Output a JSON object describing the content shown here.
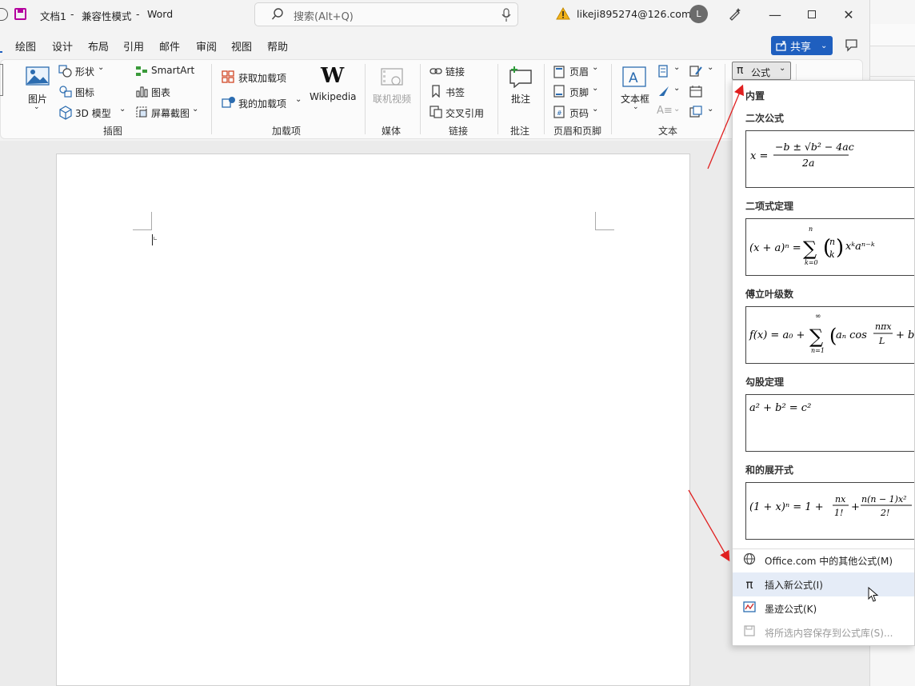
{
  "title": {
    "doc_name": "文档1",
    "separator1": "-",
    "mode": "兼容性模式",
    "separator2": "-",
    "app": "Word",
    "search_placeholder": "搜索(Alt+Q)",
    "account": "likeji895274@126.com",
    "avatar_letter": "L"
  },
  "menu": {
    "items": [
      "绘图",
      "设计",
      "布局",
      "引用",
      "邮件",
      "审阅",
      "视图",
      "帮助"
    ],
    "share": "共享"
  },
  "ribbon": {
    "illustrations": {
      "picture": "图片",
      "shapes": "形状",
      "icons": "图标",
      "model3d": "3D 模型",
      "smartart": "SmartArt",
      "chart": "图表",
      "screenshot": "屏幕截图",
      "group": "插图"
    },
    "addins": {
      "get": "获取加载项",
      "mine": "我的加载项",
      "wikipedia": "Wikipedia",
      "group": "加载项"
    },
    "media": {
      "online_video": "联机视频",
      "group": "媒体"
    },
    "links": {
      "link": "链接",
      "bookmark": "书签",
      "crossref": "交叉引用",
      "group": "链接"
    },
    "comments": {
      "comment": "批注",
      "group": "批注"
    },
    "headerfooter": {
      "header": "页眉",
      "footer": "页脚",
      "pagenum": "页码",
      "group": "页眉和页脚"
    },
    "text": {
      "textbox": "文本框",
      "group": "文本"
    },
    "equation": {
      "pi": "π",
      "label": "公式"
    }
  },
  "gallery": {
    "header": "内置",
    "items": [
      {
        "title": "二次公式"
      },
      {
        "title": "二项式定理"
      },
      {
        "title": "傅立叶级数"
      },
      {
        "title": "勾股定理"
      },
      {
        "title": "和的展开式"
      }
    ],
    "menu": [
      {
        "label": "Office.com 中的其他公式(M)",
        "icon": "globe-icon"
      },
      {
        "label": "插入新公式(I)",
        "icon": "pi-icon"
      },
      {
        "label": "墨迹公式(K)",
        "icon": "ink-equation-icon"
      },
      {
        "label": "将所选内容保存到公式库(S)...",
        "icon": "save-icon"
      }
    ]
  },
  "colors": {
    "accent": "#1f5fbf",
    "arrow": "#e02020",
    "word_purple": "#b4009e",
    "hover": "#e5ecf7"
  }
}
